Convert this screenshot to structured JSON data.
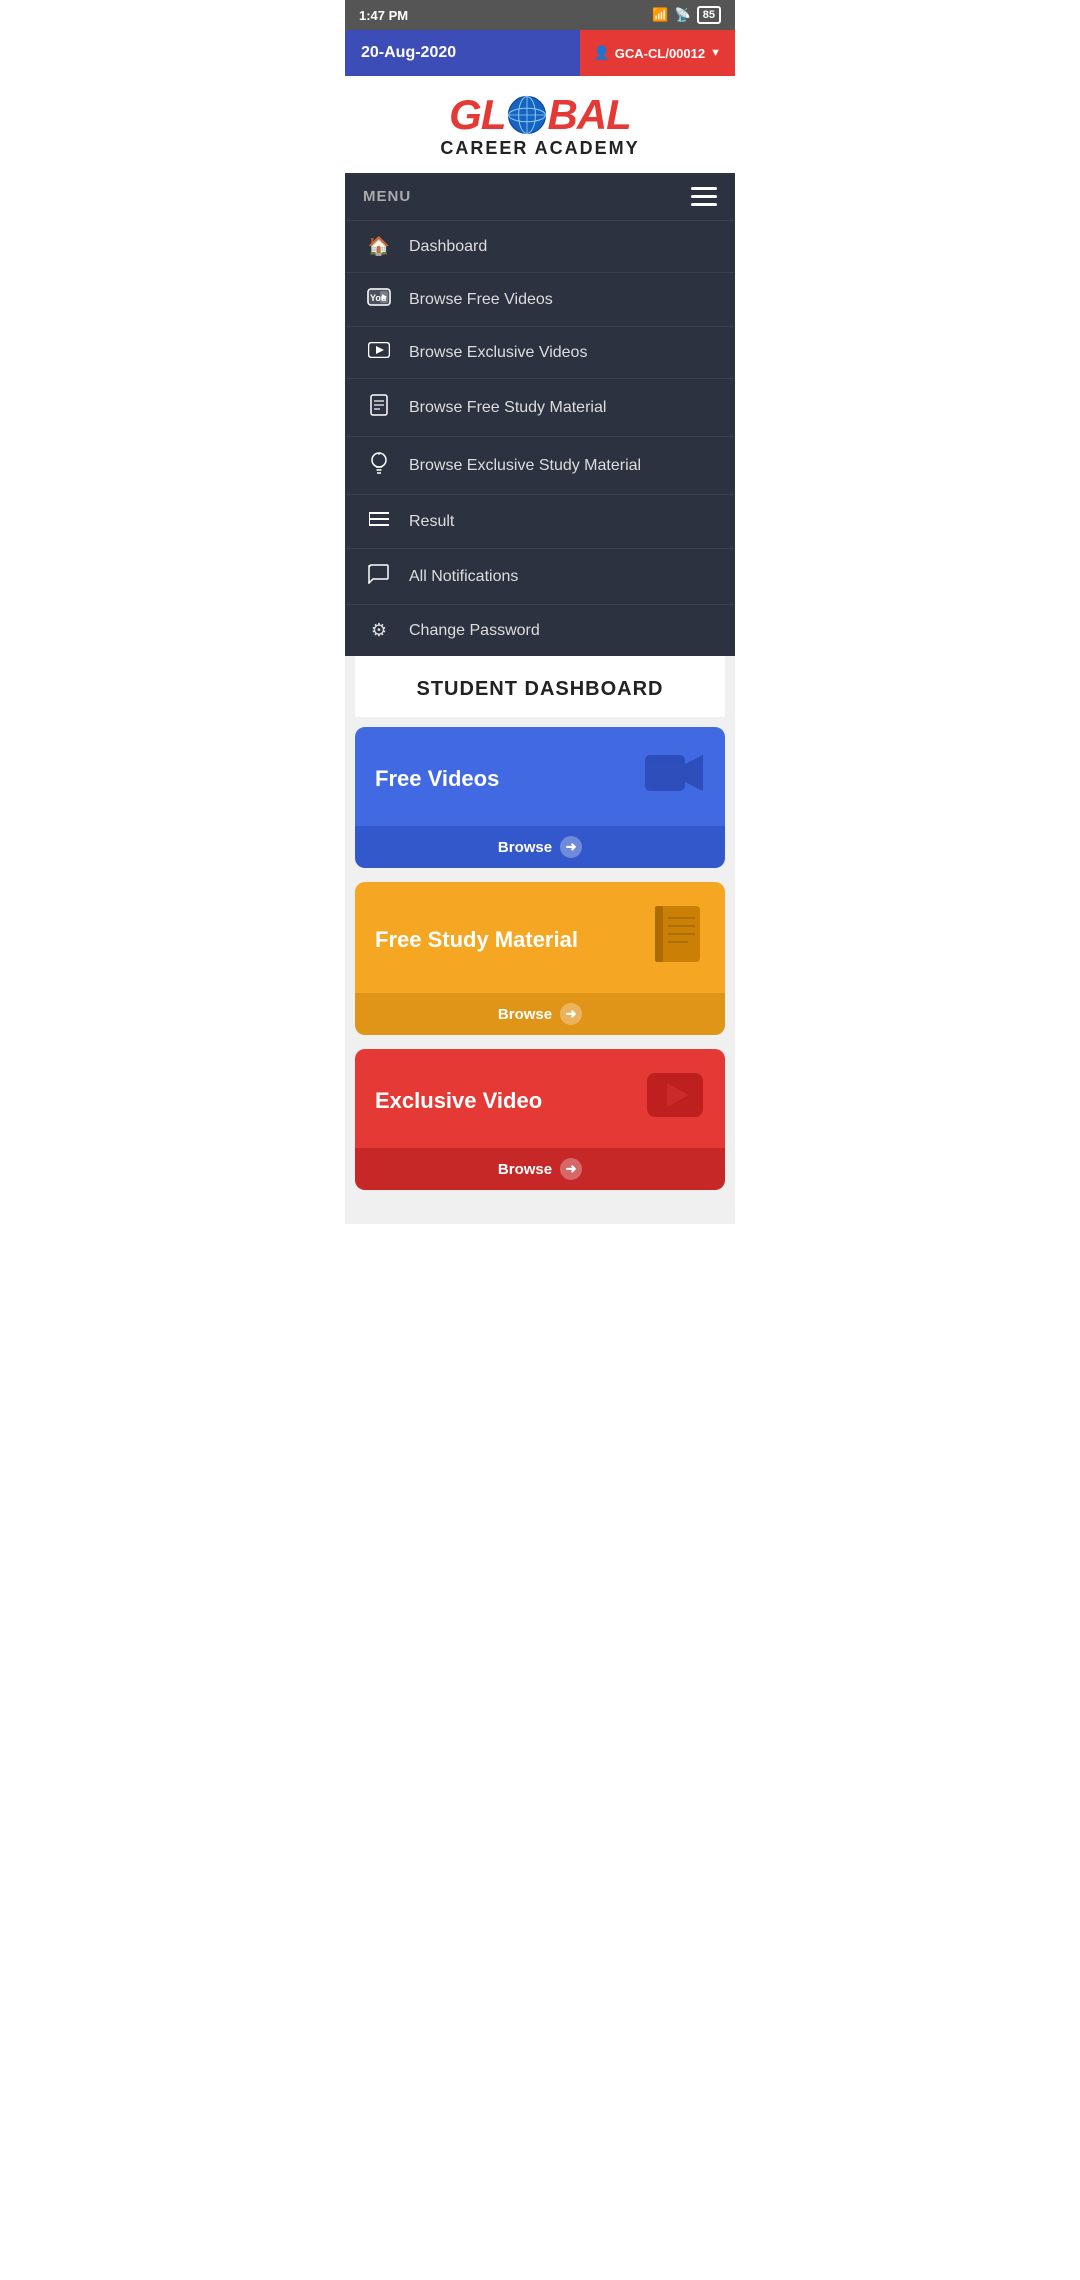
{
  "statusBar": {
    "time": "1:47 PM",
    "battery": "85"
  },
  "header": {
    "date": "20-Aug-2020",
    "userBtn": "GCA-CL/00012",
    "userIcon": "👤"
  },
  "logo": {
    "global": "GLOBAL",
    "careerAcademy": "CAREER ACADEMY"
  },
  "menu": {
    "label": "MENU",
    "items": [
      {
        "icon": "🏠",
        "label": "Dashboard",
        "name": "dashboard"
      },
      {
        "icon": "▶",
        "label": "Browse Free Videos",
        "name": "browse-free-videos",
        "iconType": "youtube"
      },
      {
        "icon": "▶",
        "label": "Browse Exclusive Videos",
        "name": "browse-exclusive-videos",
        "iconType": "play"
      },
      {
        "icon": "📋",
        "label": "Browse Free Study Material",
        "name": "browse-free-study-material",
        "iconType": "book"
      },
      {
        "icon": "💡",
        "label": "Browse Exclusive Study Material",
        "name": "browse-exclusive-study-material",
        "iconType": "bulb"
      },
      {
        "icon": "☰",
        "label": "Result",
        "name": "result",
        "iconType": "list"
      },
      {
        "icon": "💬",
        "label": "All Notifications",
        "name": "all-notifications",
        "iconType": "chat"
      },
      {
        "icon": "⚙",
        "label": "Change Password",
        "name": "change-password",
        "iconType": "gear"
      }
    ]
  },
  "dashboard": {
    "title": "STUDENT DASHBOARD",
    "cards": [
      {
        "title": "Free Videos",
        "browseLabel": "Browse",
        "colorClass": "card-blue",
        "name": "free-videos-card"
      },
      {
        "title": "Free Study Material",
        "browseLabel": "Browse",
        "colorClass": "card-yellow",
        "name": "free-study-material-card"
      },
      {
        "title": "Exclusive Video",
        "browseLabel": "Browse",
        "colorClass": "card-red",
        "name": "exclusive-video-card"
      }
    ]
  }
}
